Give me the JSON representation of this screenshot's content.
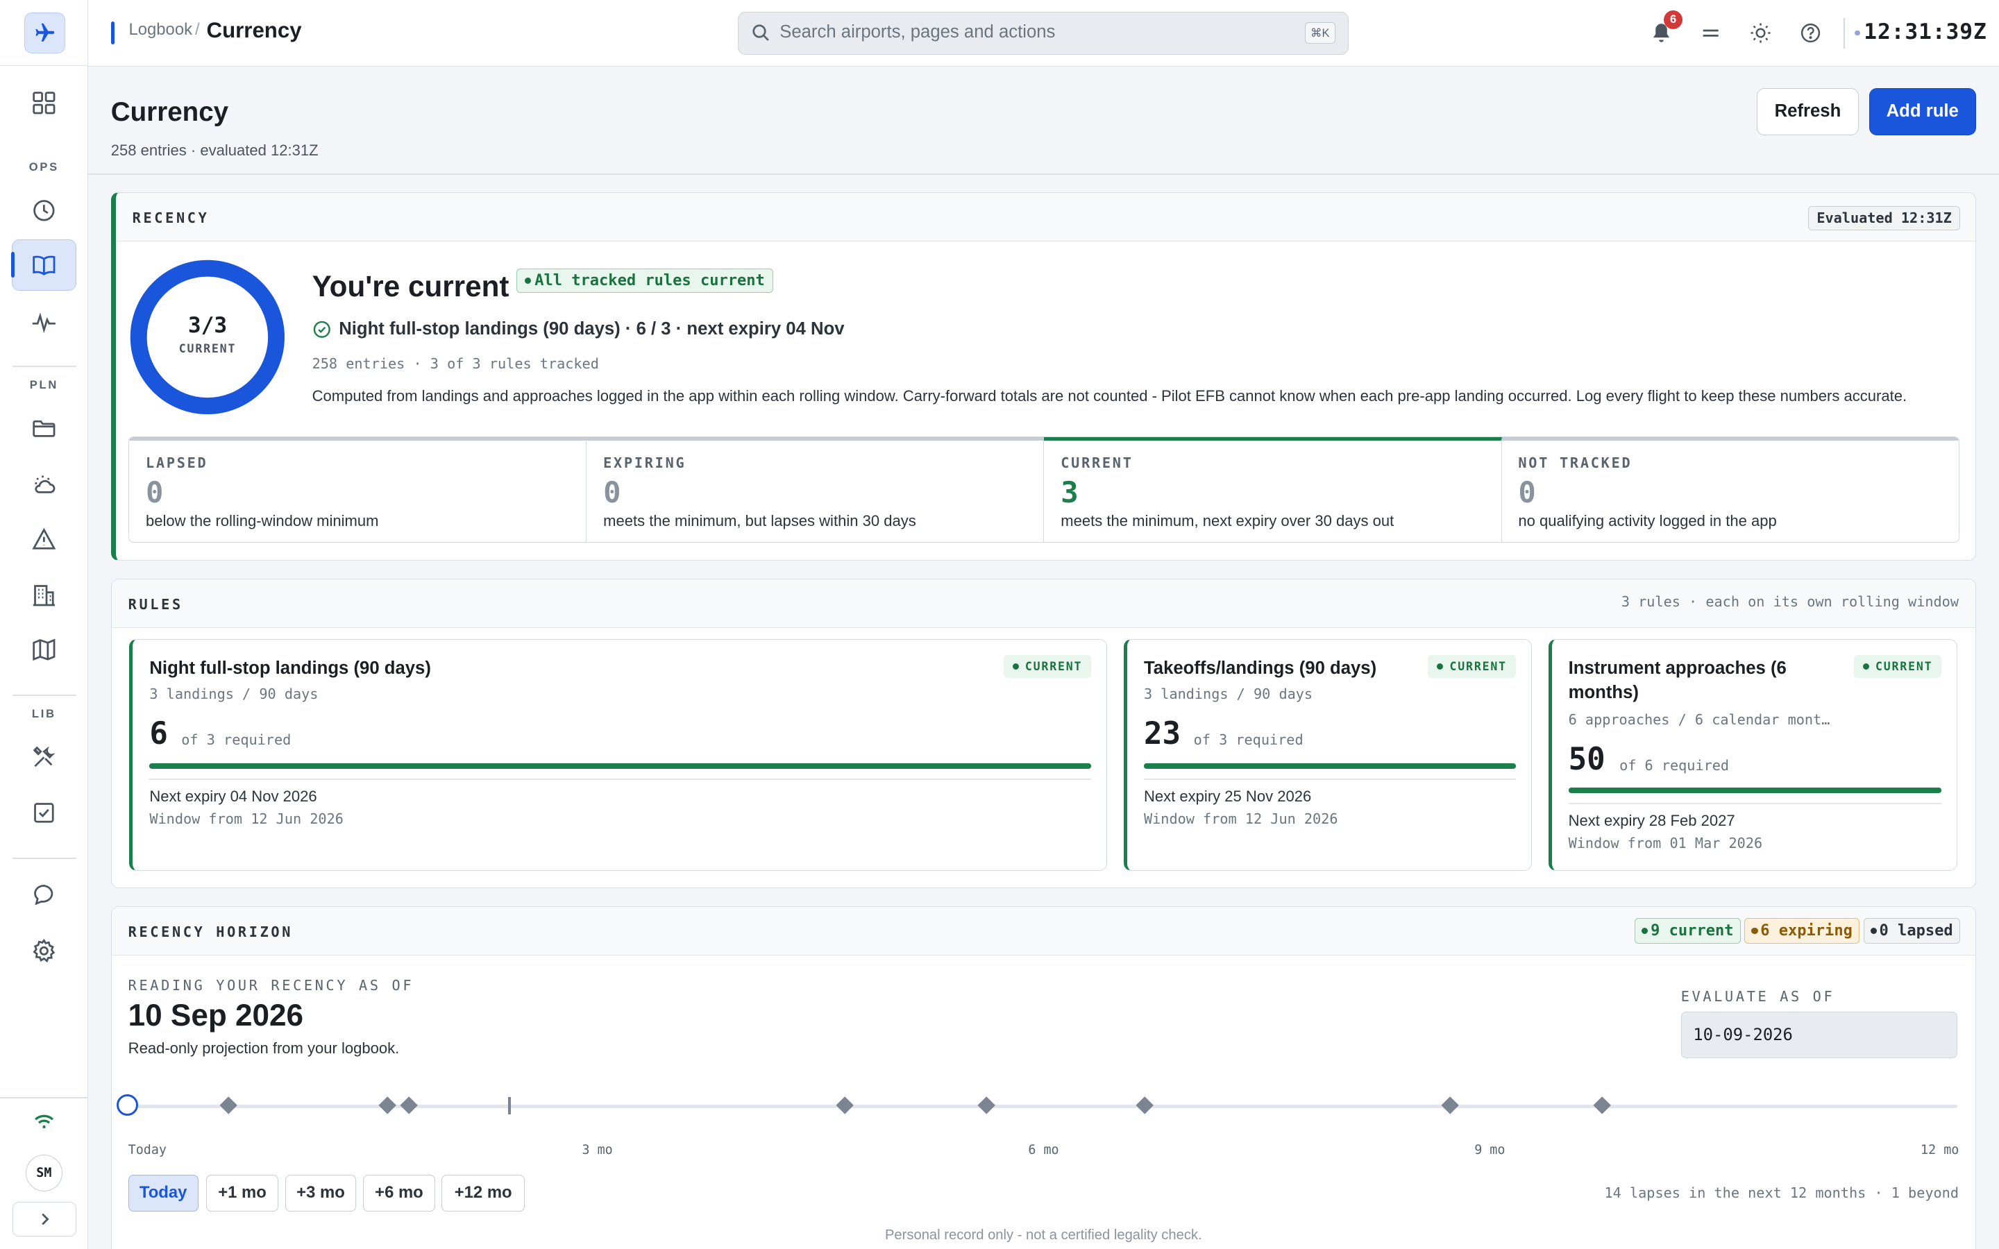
{
  "breadcrumb": {
    "parent": "Logbook",
    "separator": "/",
    "current": "Currency"
  },
  "search": {
    "placeholder": "Search airports, pages and actions",
    "shortcut": "⌘K"
  },
  "header": {
    "notifications_count": "6",
    "clock": "12:31:39Z"
  },
  "sidebar": {
    "sections": [
      "OPS",
      "PLN",
      "LIB"
    ],
    "items": [
      {
        "name": "dashboard",
        "icon": "grid-icon"
      },
      {
        "name": "history",
        "icon": "clock-icon"
      },
      {
        "name": "logbook",
        "icon": "book-icon",
        "active": true
      },
      {
        "name": "activity",
        "icon": "pulse-icon"
      },
      {
        "name": "plans",
        "icon": "folder-icon"
      },
      {
        "name": "weather",
        "icon": "weather-icon"
      },
      {
        "name": "notams",
        "icon": "warning-icon"
      },
      {
        "name": "airports",
        "icon": "building-icon"
      },
      {
        "name": "charts",
        "icon": "map-icon"
      },
      {
        "name": "tools",
        "icon": "tools-icon"
      },
      {
        "name": "checklists",
        "icon": "checklist-icon"
      },
      {
        "name": "chat",
        "icon": "chat-icon"
      },
      {
        "name": "settings",
        "icon": "gear-icon"
      }
    ],
    "avatar": "SM"
  },
  "page": {
    "title": "Currency",
    "subtitle": "258 entries · evaluated 12:31Z",
    "refresh_label": "Refresh",
    "add_label": "Add rule"
  },
  "recency": {
    "label": "RECENCY",
    "evaluated": "Evaluated 12:31Z",
    "donut_value": "3/3",
    "donut_label": "CURRENT",
    "donut_fraction": 1.0,
    "headline": "You're current",
    "chip": "All tracked rules current",
    "status_line": "Night full-stop landings (90 days) · 6 / 3 · next expiry 04 Nov",
    "meta": "258 entries · 3 of 3 rules tracked",
    "description": "Computed from landings and approaches logged in the app within each rolling window. Carry-forward totals are not counted - Pilot EFB cannot know when each pre-app landing occurred. Log every flight to keep these numbers accurate.",
    "stats": [
      {
        "label": "LAPSED",
        "value": "0",
        "desc": "below the rolling-window minimum"
      },
      {
        "label": "EXPIRING",
        "value": "0",
        "desc": "meets the minimum, but lapses within 30 days"
      },
      {
        "label": "CURRENT",
        "value": "3",
        "desc": "meets the minimum, next expiry over 30 days out"
      },
      {
        "label": "NOT TRACKED",
        "value": "0",
        "desc": "no qualifying activity logged in the app"
      }
    ]
  },
  "rules": {
    "label": "RULES",
    "summary": "3 rules · each on its own rolling window",
    "items": [
      {
        "title": "Night full-stop landings (90 days)",
        "spec": "3 landings / 90 days",
        "status": "CURRENT",
        "value": "6",
        "of": "of 3 required",
        "progress": 1.0,
        "next": "Next expiry 04 Nov 2026",
        "window": "Window from 12 Jun 2026"
      },
      {
        "title": "Takeoffs/landings (90 days)",
        "spec": "3 landings / 90 days",
        "status": "CURRENT",
        "value": "23",
        "of": "of 3 required",
        "progress": 1.0,
        "next": "Next expiry 25 Nov 2026",
        "window": "Window from 12 Jun 2026"
      },
      {
        "title": "Instrument approaches (6 months)",
        "spec": "6 approaches / 6 calendar mont…",
        "status": "CURRENT",
        "value": "50",
        "of": "of 6 required",
        "progress": 1.0,
        "next": "Next expiry 28 Feb 2027",
        "window": "Window from 01 Mar 2026"
      }
    ]
  },
  "horizon": {
    "label": "RECENCY HORIZON",
    "pills": {
      "current": "9 current",
      "expiring": "6 expiring",
      "lapsed": "0 lapsed"
    },
    "reading_label": "READING YOUR RECENCY AS OF",
    "date": "10 Sep 2026",
    "sub": "Read-only projection from your logbook.",
    "evaluate_label": "EVALUATE AS OF",
    "evaluate_value": "10-09-2026",
    "tick_labels": [
      "Today",
      "3 mo",
      "6 mo",
      "9 mo",
      "12 mo"
    ],
    "events_months": [
      0.66,
      1.7,
      1.84,
      4.7,
      5.63,
      6.67,
      8.67,
      9.67
    ],
    "marker_months": 2.5,
    "buttons": [
      "Today",
      "+1 mo",
      "+3 mo",
      "+6 mo",
      "+12 mo"
    ],
    "footer": "14 lapses in the next 12 months · 1 beyond"
  },
  "disclaimer": "Personal record only - not a certified legality check.",
  "colors": {
    "accent": "#1a56db",
    "current": "#1a7f4b",
    "expiring": "#8d5b05",
    "alert": "#d23a3a"
  }
}
